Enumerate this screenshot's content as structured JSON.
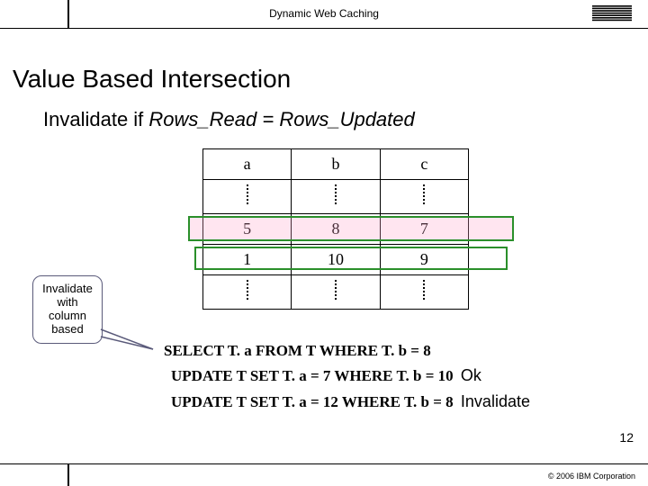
{
  "header": {
    "title": "Dynamic Web Caching",
    "logo_alt": "IBM"
  },
  "title": "Value Based Intersection",
  "subtitle": {
    "prefix": "Invalidate if  ",
    "expr": "Rows_Read = Rows_Updated"
  },
  "table": {
    "headers": [
      "a",
      "b",
      "c"
    ],
    "row_hl_pink": [
      "5",
      "8",
      "7"
    ],
    "row_hl_none": [
      "1",
      "10",
      "9"
    ]
  },
  "callout": "Invalidate with column based",
  "sql": {
    "select": "SELECT T. a FROM T WHERE T. b = 8",
    "update1": "UPDATE T SET T. a = 7 WHERE T. b = 10",
    "update1_annot": "Ok",
    "update2": "UPDATE T SET T. a = 12 WHERE T. b = 8",
    "update2_annot": "Invalidate"
  },
  "slide_number": "12",
  "copyright": "© 2006 IBM Corporation"
}
